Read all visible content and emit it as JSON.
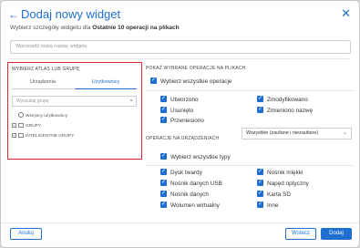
{
  "header": {
    "title": "Dodaj nowy widget",
    "subtitle_prefix": "Wybierz szczegóły widgetu dla ",
    "subtitle_bold": "Ostatnie 10 operacji na plikach",
    "name_placeholder": "Wprowadź nową nazwę widgetu"
  },
  "left": {
    "heading": "WYBIERZ ATLAS LUB GRUPĘ",
    "tabs": [
      "Urządzenia",
      "Użytkownicy"
    ],
    "active_tab": "Użytkownicy",
    "search_placeholder": "Wyszukaj grupę",
    "tree": [
      {
        "label": "Wszyscy użytkownicy",
        "icon": "globe-icon"
      },
      {
        "label": "GRUPY",
        "icon": "folder-icon"
      },
      {
        "label": "INTELIGENTNE GRUPY",
        "icon": "folder-icon"
      }
    ]
  },
  "right": {
    "ops_heading": "POKAŻ WYBRANE OPERACJE NA PLIKACH",
    "select_all_ops": "Wybierz wszystkie operacje",
    "ops": [
      "Utworzono",
      "Zmodyfikowano",
      "Usunięto",
      "Zmieniono nazwę",
      "Przeniesiono"
    ],
    "device_heading": "OPERACJE NA URZĄDZENIACH",
    "device_select": "Wszystkie (zaufane i niezaufane)",
    "select_all_types": "Wybierz wszystkie typy",
    "types": [
      "Dysk twardy",
      "Nośnik miękki",
      "Nośnik danych USB",
      "Napęd optyczny",
      "Nośnik danych",
      "Karta SD",
      "Wolumen wirtualny",
      "Inne"
    ]
  },
  "footer": {
    "cancel": "Anuluj",
    "back": "Wstecz",
    "add": "Dodaj"
  },
  "colors": {
    "accent": "#1e6fcf",
    "highlight": "#e0252b"
  }
}
